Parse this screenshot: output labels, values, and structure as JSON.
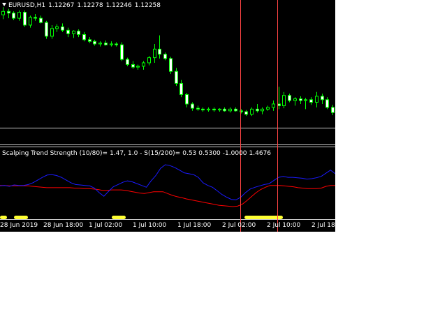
{
  "chart_window": {
    "symbol": "EURUSD,H1",
    "open": "1.12267",
    "high": "1.12278",
    "low": "1.12246",
    "close": "1.12258"
  },
  "indicator": {
    "name": "Scalping Trend Strength",
    "params": "(10/80)=",
    "val1": "1.47,",
    "val2": "1.0 - S(15/200)=",
    "val3": "0.53",
    "val4": "0.5300",
    "val5": "-1.0000",
    "val6": "1.4676"
  },
  "time_axis": [
    "28 Jun 2019",
    "28 Jun 18:00",
    "1 Jul 02:00",
    "1 Jul 10:00",
    "1 Jul 18:00",
    "2 Jul 02:00",
    "2 Jul 10:00",
    "2 Jul 18:"
  ],
  "colors": {
    "background": "#000000",
    "bull_candle": "#00ff00",
    "bear_candle": "#ffffff",
    "blue_line": "#1a1aff",
    "red_line": "#ff0000",
    "signal": "#ffff33",
    "cursor_line": "#ff4444"
  },
  "candles": [
    [
      1.12322,
      1.12331,
      1.12317,
      1.12326
    ],
    [
      1.12326,
      1.12329,
      1.12318,
      1.12324
    ],
    [
      1.12324,
      1.12326,
      1.12316,
      1.12318
    ],
    [
      1.12318,
      1.12327,
      1.12315,
      1.12325
    ],
    [
      1.12325,
      1.12327,
      1.12308,
      1.1231
    ],
    [
      1.1231,
      1.12321,
      1.12307,
      1.12319
    ],
    [
      1.12319,
      1.12323,
      1.12315,
      1.12318
    ],
    [
      1.12318,
      1.12321,
      1.12312,
      1.12313
    ],
    [
      1.12313,
      1.12315,
      1.12294,
      1.12297
    ],
    [
      1.12297,
      1.1231,
      1.12294,
      1.12306
    ],
    [
      1.12306,
      1.12311,
      1.12302,
      1.12308
    ],
    [
      1.12308,
      1.12312,
      1.12302,
      1.12304
    ],
    [
      1.12304,
      1.12307,
      1.12296,
      1.123
    ],
    [
      1.123,
      1.12304,
      1.12295,
      1.12303
    ],
    [
      1.12303,
      1.12305,
      1.12296,
      1.12299
    ],
    [
      1.12299,
      1.12302,
      1.12291,
      1.12293
    ],
    [
      1.12293,
      1.12296,
      1.12289,
      1.12291
    ],
    [
      1.12291,
      1.12293,
      1.12286,
      1.12288
    ],
    [
      1.12288,
      1.12291,
      1.12285,
      1.12289
    ],
    [
      1.12289,
      1.12292,
      1.12286,
      1.12287
    ],
    [
      1.12287,
      1.12291,
      1.12285,
      1.12288
    ],
    [
      1.12288,
      1.1229,
      1.12285,
      1.12287
    ],
    [
      1.12287,
      1.1229,
      1.12268,
      1.1227
    ],
    [
      1.1227,
      1.12272,
      1.12262,
      1.12264
    ],
    [
      1.12264,
      1.12268,
      1.12259,
      1.12261
    ],
    [
      1.12261,
      1.12264,
      1.12258,
      1.12262
    ],
    [
      1.12262,
      1.12268,
      1.12258,
      1.12266
    ],
    [
      1.12266,
      1.12274,
      1.12263,
      1.12272
    ],
    [
      1.12272,
      1.12288,
      1.12266,
      1.12282
    ],
    [
      1.12282,
      1.12298,
      1.12271,
      1.12276
    ],
    [
      1.12276,
      1.12278,
      1.12269,
      1.12271
    ],
    [
      1.12271,
      1.12273,
      1.12253,
      1.12256
    ],
    [
      1.12256,
      1.1226,
      1.12239,
      1.12242
    ],
    [
      1.12242,
      1.12246,
      1.12226,
      1.12229
    ],
    [
      1.12229,
      1.12231,
      1.12214,
      1.12218
    ],
    [
      1.12218,
      1.1222,
      1.1221,
      1.12213
    ],
    [
      1.12213,
      1.12216,
      1.1221,
      1.12212
    ],
    [
      1.12212,
      1.12214,
      1.12209,
      1.12211
    ],
    [
      1.12211,
      1.12214,
      1.12209,
      1.12212
    ],
    [
      1.12212,
      1.12214,
      1.12209,
      1.12211
    ],
    [
      1.12211,
      1.12213,
      1.12209,
      1.12212
    ],
    [
      1.12212,
      1.12214,
      1.12209,
      1.1221
    ],
    [
      1.1221,
      1.12214,
      1.12208,
      1.12212
    ],
    [
      1.12212,
      1.12214,
      1.12209,
      1.1221
    ],
    [
      1.1221,
      1.12212,
      1.12207,
      1.12209
    ],
    [
      1.12209,
      1.12211,
      1.12204,
      1.12206
    ],
    [
      1.12206,
      1.12214,
      1.12204,
      1.12212
    ],
    [
      1.12212,
      1.12218,
      1.12208,
      1.1221
    ],
    [
      1.1221,
      1.12214,
      1.12206,
      1.12212
    ],
    [
      1.12212,
      1.12216,
      1.1221,
      1.12214
    ],
    [
      1.12214,
      1.12222,
      1.1221,
      1.12218
    ],
    [
      1.12218,
      1.12238,
      1.12212,
      1.12216
    ],
    [
      1.12216,
      1.12232,
      1.12213,
      1.12228
    ],
    [
      1.12228,
      1.1223,
      1.1222,
      1.12222
    ],
    [
      1.12222,
      1.12226,
      1.12216,
      1.12224
    ],
    [
      1.12224,
      1.12227,
      1.12218,
      1.12222
    ],
    [
      1.12222,
      1.12225,
      1.12212,
      1.12223
    ],
    [
      1.12223,
      1.12226,
      1.12217,
      1.1222
    ],
    [
      1.1222,
      1.12232,
      1.12214,
      1.12227
    ],
    [
      1.12227,
      1.1223,
      1.12218,
      1.12223
    ],
    [
      1.12223,
      1.12226,
      1.12212,
      1.12214
    ],
    [
      1.12214,
      1.12217,
      1.12205,
      1.12208
    ]
  ],
  "blue_line": [
    0.55,
    0.56,
    0.54,
    0.57,
    0.56,
    0.56,
    0.58,
    0.62,
    0.68,
    0.74,
    0.79,
    0.8,
    0.78,
    0.74,
    0.68,
    0.62,
    0.58,
    0.57,
    0.56,
    0.55,
    0.5,
    0.4,
    0.32,
    0.43,
    0.53,
    0.58,
    0.63,
    0.66,
    0.64,
    0.6,
    0.56,
    0.52,
    0.66,
    0.78,
    0.94,
    1.02,
    1.0,
    0.96,
    0.9,
    0.84,
    0.82,
    0.8,
    0.74,
    0.62,
    0.56,
    0.52,
    0.44,
    0.36,
    0.3,
    0.25,
    0.24,
    0.3,
    0.4,
    0.48,
    0.52,
    0.55,
    0.58,
    0.6,
    0.67,
    0.74,
    0.76,
    0.74,
    0.74,
    0.73,
    0.72,
    0.7,
    0.71,
    0.73,
    0.76,
    0.83,
    0.9,
    0.82
  ],
  "red_line": [
    0.56,
    0.56,
    0.55,
    0.55,
    0.55,
    0.55,
    0.55,
    0.54,
    0.53,
    0.52,
    0.51,
    0.51,
    0.51,
    0.51,
    0.51,
    0.51,
    0.5,
    0.5,
    0.49,
    0.49,
    0.48,
    0.47,
    0.45,
    0.45,
    0.46,
    0.46,
    0.46,
    0.45,
    0.43,
    0.41,
    0.39,
    0.38,
    0.4,
    0.42,
    0.42,
    0.42,
    0.38,
    0.34,
    0.31,
    0.29,
    0.26,
    0.24,
    0.22,
    0.2,
    0.18,
    0.16,
    0.14,
    0.12,
    0.11,
    0.1,
    0.09,
    0.1,
    0.14,
    0.22,
    0.31,
    0.4,
    0.47,
    0.52,
    0.56,
    0.56,
    0.56,
    0.55,
    0.54,
    0.53,
    0.51,
    0.5,
    0.49,
    0.49,
    0.49,
    0.5,
    0.54,
    0.56,
    0.56
  ],
  "signal_active": [
    1,
    1,
    0,
    0,
    1,
    1,
    1,
    1,
    0,
    0,
    0,
    0,
    0,
    0,
    0,
    0,
    0,
    0,
    0,
    0,
    0,
    0,
    0,
    0,
    0,
    0,
    0,
    0,
    0,
    0,
    0,
    0,
    1,
    1,
    1,
    1,
    0,
    0,
    0,
    0,
    0,
    0,
    0,
    0,
    0,
    0,
    0,
    0,
    0,
    0,
    0,
    0,
    0,
    0,
    0,
    0,
    0,
    0,
    0,
    0,
    0,
    0,
    0,
    0,
    0,
    0,
    0,
    0,
    0,
    0,
    1,
    1,
    1,
    1,
    1,
    1,
    1,
    1,
    1,
    1,
    1,
    0,
    0,
    0,
    0,
    0,
    0,
    0,
    0,
    0,
    0,
    0,
    0,
    0,
    0,
    0
  ]
}
